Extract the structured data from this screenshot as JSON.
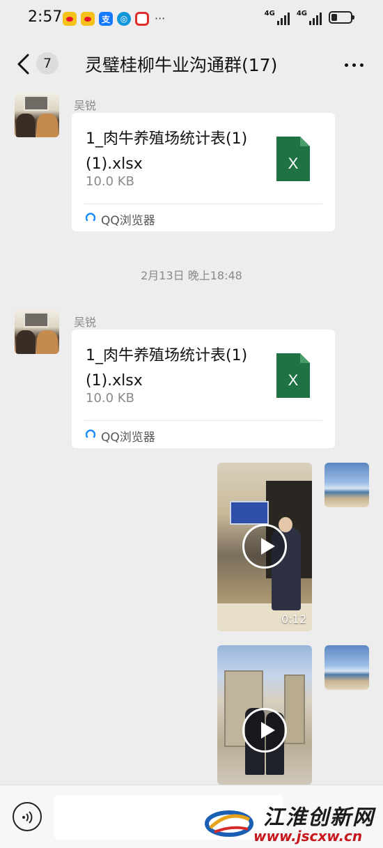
{
  "status_bar": {
    "time": "2:57",
    "more": "···",
    "signal_1_label": "4G",
    "signal_2_label": "4G",
    "app_icons": [
      "weibo-icon",
      "weibo-icon",
      "alipay-icon",
      "qq-browser-icon",
      "notification-icon"
    ]
  },
  "nav": {
    "unread_count": "7",
    "title": "灵璧桂柳牛业沟通群(17)"
  },
  "messages": [
    {
      "type": "file",
      "sender": "吴锐",
      "file_name": "1_肉牛养殖场统计表(1)(1).xlsx",
      "file_size": "10.0 KB",
      "source_app": "QQ浏览器"
    },
    {
      "type": "file",
      "sender": "吴锐",
      "file_name": "1_肉牛养殖场统计表(1)(1).xlsx",
      "file_size": "10.0 KB",
      "source_app": "QQ浏览器"
    },
    {
      "type": "video",
      "sender": "self",
      "duration": "0:12"
    },
    {
      "type": "video",
      "sender": "self",
      "duration": ""
    }
  ],
  "time_separator": "2月13日 晚上18:48",
  "watermark": {
    "title": "江淮创新网",
    "url": "www.jscxw.cn"
  },
  "colors": {
    "background": "#ededed",
    "bubble": "#ffffff",
    "excel_green": "#1f7244",
    "watermark_red": "#c8161d"
  }
}
